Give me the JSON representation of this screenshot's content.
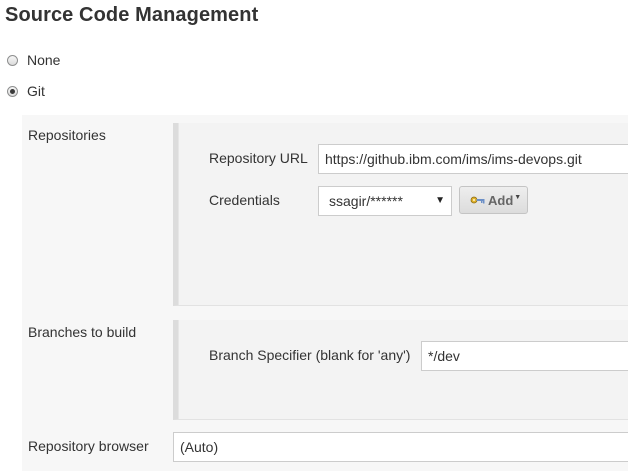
{
  "page": {
    "title": "Source Code Management"
  },
  "scm": {
    "options": [
      {
        "label": "None",
        "checked": false
      },
      {
        "label": "Git",
        "checked": true
      }
    ]
  },
  "git": {
    "repositories": {
      "label": "Repositories",
      "url_label": "Repository URL",
      "url_value": "https://github.ibm.com/ims/ims-devops.git",
      "credentials_label": "Credentials",
      "credentials_value": "ssagir/******",
      "add_label": "Add"
    },
    "branches": {
      "label": "Branches to build",
      "specifier_label": "Branch Specifier (blank for 'any')",
      "specifier_value": "*/dev"
    },
    "browser": {
      "label": "Repository browser",
      "value": "(Auto)"
    }
  },
  "icons": {
    "key": "key-icon",
    "dropdown": "chevron-down-icon",
    "add_caret": "caret-down-icon"
  }
}
